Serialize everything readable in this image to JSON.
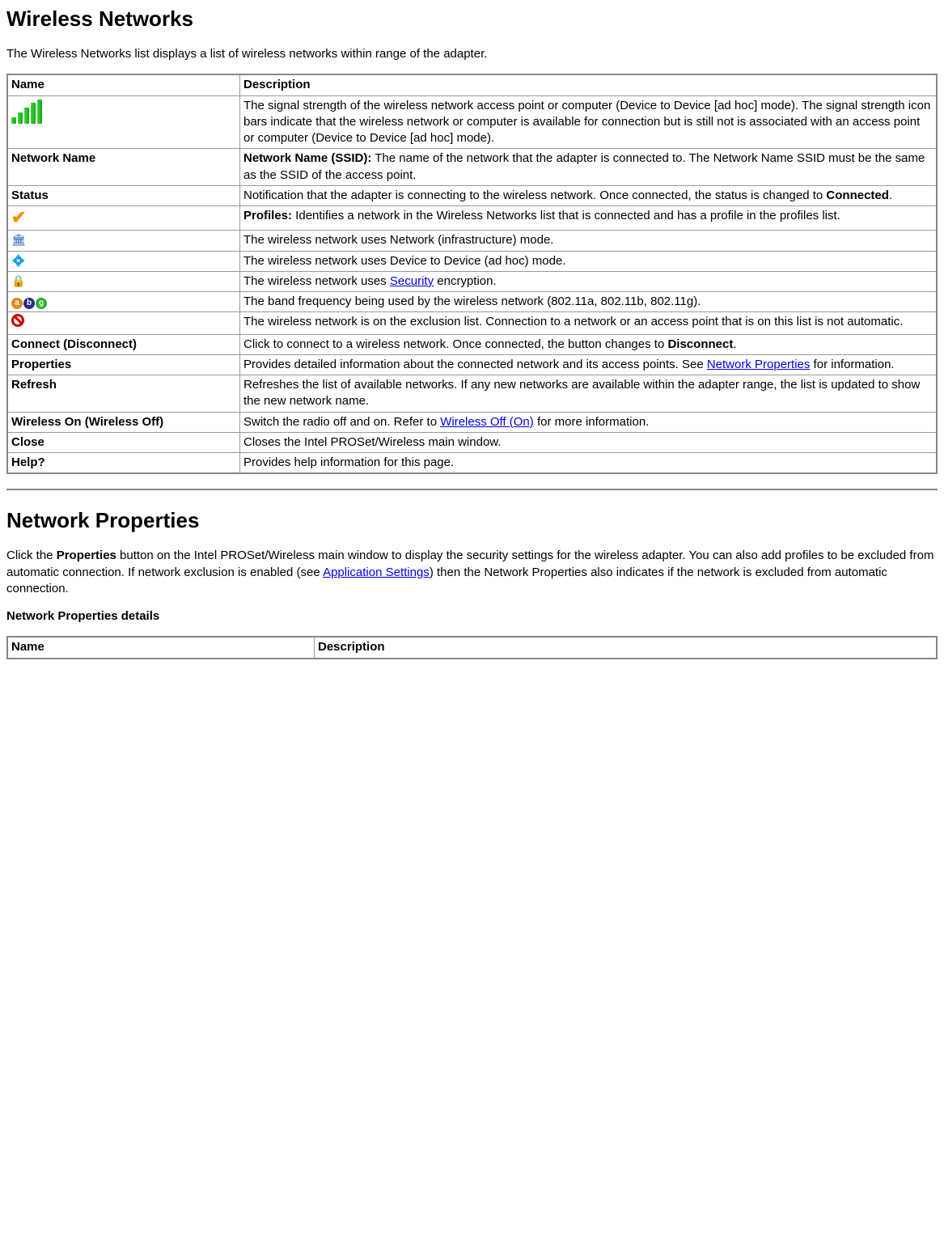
{
  "sec1": {
    "heading": "Wireless Networks",
    "intro": "The Wireless Networks list displays a list of wireless networks within range of the adapter.",
    "header_name": "Name",
    "header_desc": "Description",
    "rows": {
      "signal_name": "",
      "signal_desc": "The signal strength of the wireless network access point or computer (Device to Device [ad hoc] mode). The signal strength icon bars indicate that the wireless network or computer is available for connection but is still not is associated with an access point or computer (Device to Device [ad hoc] mode).",
      "netname_name": "Network Name",
      "netname_desc_b": "Network Name (SSID):",
      "netname_desc_rest": " The name of the network that the adapter is connected to. The Network Name SSID must be the same as the SSID of the access point.",
      "status_name": "Status",
      "status_desc_a": "Notification that the adapter is connecting to the wireless network. Once connected, the status is changed to ",
      "status_desc_b": "Connected",
      "status_desc_c": ".",
      "profiles_desc_b": "Profiles:",
      "profiles_desc_rest": " Identifies a network in the Wireless Networks list that is connected and has a profile in the profiles list.",
      "infra_desc": "The wireless network uses Network (infrastructure) mode.",
      "adhoc_desc": "The wireless network uses Device to Device (ad hoc) mode.",
      "sec_desc_a": "The wireless network uses ",
      "sec_link": "Security",
      "sec_desc_b": " encryption.",
      "band_desc": "The band frequency being used by the wireless network (802.11a, 802.11b, 802.11g).",
      "excl_desc": "The wireless network is on the exclusion list. Connection to a network or an access point that is on this list is not automatic.",
      "connect_name": "Connect (Disconnect)",
      "connect_desc_a": "Click to connect to a wireless network. Once connected, the button changes to ",
      "connect_desc_b": "Disconnect",
      "connect_desc_c": ".",
      "props_name": "Properties",
      "props_desc_a": "Provides detailed information about the connected network and its access points. See ",
      "props_link": "Network Properties",
      "props_desc_b": " for information.",
      "refresh_name": "Refresh",
      "refresh_desc": "Refreshes the list of available networks. If any new networks are available within the adapter range, the list is updated to show the new network name.",
      "wireless_name": "Wireless On (Wireless Off)",
      "wireless_desc_a": "Switch the radio off and on. Refer to ",
      "wireless_link": "Wireless Off (On)",
      "wireless_desc_b": " for more information.",
      "close_name": "Close",
      "close_desc": "Closes the Intel PROSet/Wireless main window.",
      "help_name": "Help?",
      "help_desc": "Provides help information for this page."
    }
  },
  "sec2": {
    "heading": "Network Properties",
    "intro_a": "Click the ",
    "intro_b": "Properties",
    "intro_c": " button on the Intel PROSet/Wireless main window to display the security settings for the wireless adapter. You can also add profiles to be excluded from automatic connection. If network exclusion is enabled (see ",
    "intro_link": "Application Settings",
    "intro_d": ") then the Network Properties also indicates if the network is excluded from automatic connection.",
    "subhead": "Network Properties details",
    "header_name": "Name",
    "header_desc": "Description"
  }
}
